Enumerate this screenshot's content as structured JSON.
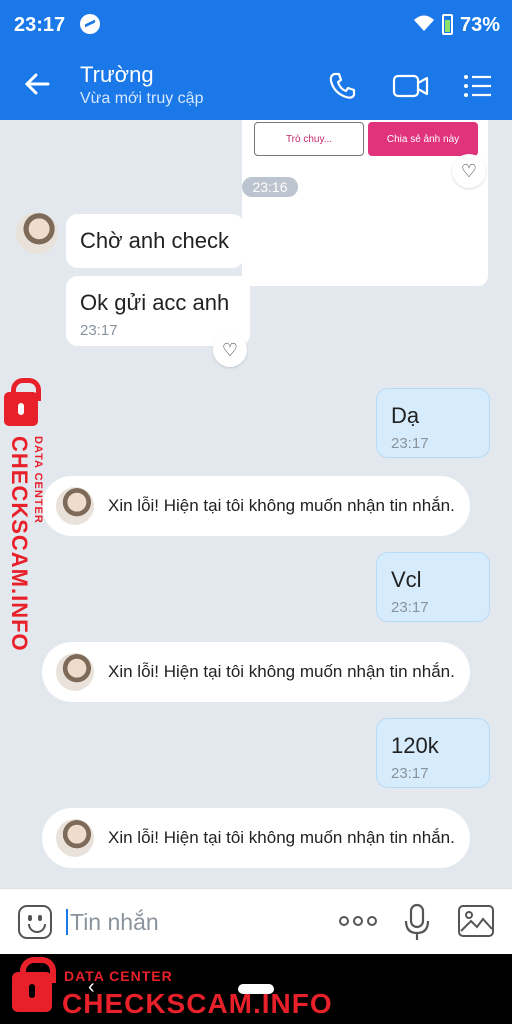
{
  "status_bar": {
    "time": "23:17",
    "battery": "73%"
  },
  "header": {
    "name": "Trường",
    "status": "Vừa mới truy cập"
  },
  "card": {
    "button_left": "Trò chuy...",
    "button_right": "Chia sẻ ảnh này"
  },
  "time_separator": "23:16",
  "messages": [
    {
      "text": "Chờ anh check"
    },
    {
      "text": "Ok gửi acc anh",
      "time": "23:17"
    },
    {
      "text": "Dạ",
      "time": "23:17"
    },
    {
      "text": "Xin lỗi! Hiện tại tôi không muốn nhận tin nhắn."
    },
    {
      "text": "Vcl",
      "time": "23:17"
    },
    {
      "text": "Xin lỗi! Hiện tại tôi không muốn nhận tin nhắn."
    },
    {
      "text": "120k",
      "time": "23:17"
    },
    {
      "text": "Xin lỗi! Hiện tại tôi không muốn nhận tin nhắn."
    }
  ],
  "input": {
    "placeholder": "Tin nhắn"
  },
  "watermark": {
    "small": "DATA CENTER",
    "big": "CHECKSCAM.INFO"
  },
  "colors": {
    "header": "#1a78e8",
    "watermark": "#e8202a",
    "outgoing_bubble": "#d6ecfc"
  },
  "icons": [
    "back-arrow-icon",
    "phone-icon",
    "video-call-icon",
    "menu-list-icon",
    "heart-icon",
    "emoji-icon",
    "more-icon",
    "mic-icon",
    "image-icon",
    "lock-icon"
  ]
}
